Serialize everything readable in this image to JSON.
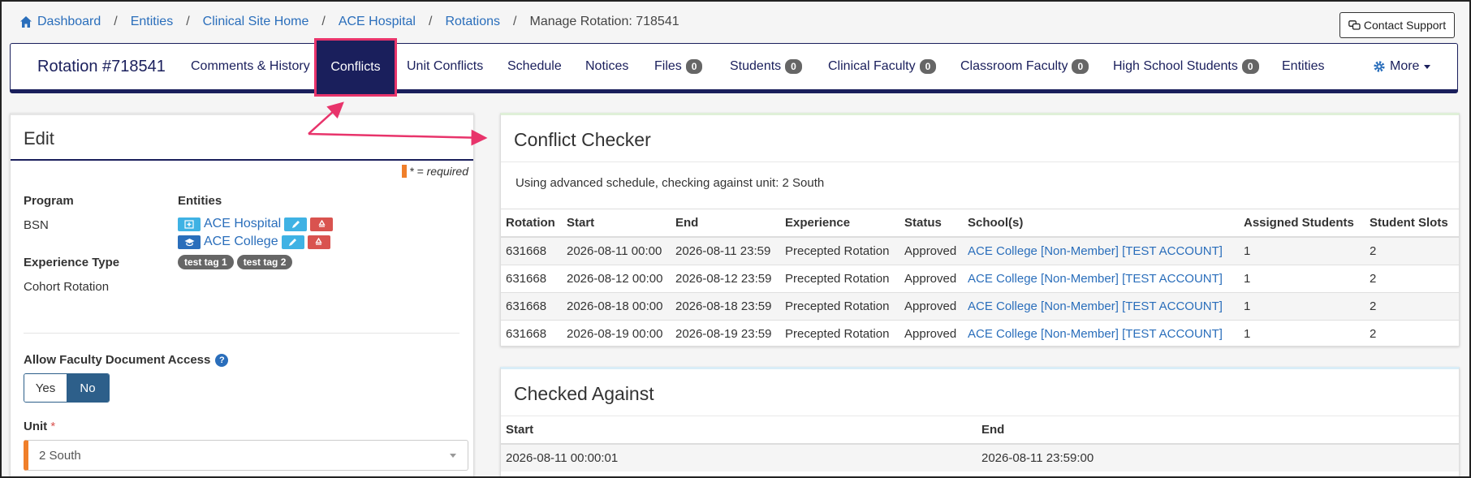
{
  "breadcrumb": {
    "items": [
      "Dashboard",
      "Entities",
      "Clinical Site Home",
      "ACE Hospital",
      "Rotations"
    ],
    "current": "Manage Rotation: 718541",
    "separator": "/"
  },
  "contact_support": "Contact Support",
  "nav": {
    "title": "Rotation #718541",
    "comments": "Comments & History",
    "conflicts": "Conflicts",
    "unit_conflicts": "Unit Conflicts",
    "schedule": "Schedule",
    "notices": "Notices",
    "files": "Files",
    "files_count": "0",
    "students": "Students",
    "students_count": "0",
    "clinical_faculty": "Clinical Faculty",
    "clinical_faculty_count": "0",
    "classroom_faculty": "Classroom Faculty",
    "classroom_faculty_count": "0",
    "hs_students": "High School Students",
    "hs_students_count": "0",
    "entities": "Entities",
    "more": "More"
  },
  "edit": {
    "title": "Edit",
    "required_note": "* = required",
    "program_label": "Program",
    "program_value": "BSN",
    "entities_label": "Entities",
    "entity_1": "ACE Hospital",
    "entity_2": "ACE College",
    "tags": [
      "test tag 1",
      "test tag 2"
    ],
    "experience_label": "Experience Type",
    "experience_value": "Cohort Rotation",
    "faculty_access_label": "Allow Faculty Document Access",
    "help": "?",
    "yes": "Yes",
    "no": "No",
    "unit_label": "Unit",
    "unit_required": "*",
    "unit_value": "2 South"
  },
  "conflict_checker": {
    "title": "Conflict Checker",
    "subtitle": "Using advanced schedule, checking against unit: 2 South",
    "headers": [
      "Rotation",
      "Start",
      "End",
      "Experience",
      "Status",
      "School(s)",
      "Assigned Students",
      "Student Slots"
    ],
    "rows": [
      {
        "rotation": "631668",
        "start": "2026-08-11 00:00",
        "end": "2026-08-11 23:59",
        "experience": "Precepted Rotation",
        "status": "Approved",
        "school": "ACE College [Non-Member] [TEST ACCOUNT]",
        "assigned": "1",
        "slots": "2"
      },
      {
        "rotation": "631668",
        "start": "2026-08-12 00:00",
        "end": "2026-08-12 23:59",
        "experience": "Precepted Rotation",
        "status": "Approved",
        "school": "ACE College [Non-Member] [TEST ACCOUNT]",
        "assigned": "1",
        "slots": "2"
      },
      {
        "rotation": "631668",
        "start": "2026-08-18 00:00",
        "end": "2026-08-18 23:59",
        "experience": "Precepted Rotation",
        "status": "Approved",
        "school": "ACE College [Non-Member] [TEST ACCOUNT]",
        "assigned": "1",
        "slots": "2"
      },
      {
        "rotation": "631668",
        "start": "2026-08-19 00:00",
        "end": "2026-08-19 23:59",
        "experience": "Precepted Rotation",
        "status": "Approved",
        "school": "ACE College [Non-Member] [TEST ACCOUNT]",
        "assigned": "1",
        "slots": "2"
      }
    ]
  },
  "checked_against": {
    "title": "Checked Against",
    "headers": [
      "Start",
      "End"
    ],
    "rows": [
      {
        "start": "2026-08-11 00:00:01",
        "end": "2026-08-11 23:59:00"
      }
    ]
  },
  "colors": {
    "navy": "#1a1f5c",
    "link": "#2a6ebb",
    "highlight": "#e8346b",
    "required": "#f07f2a"
  }
}
